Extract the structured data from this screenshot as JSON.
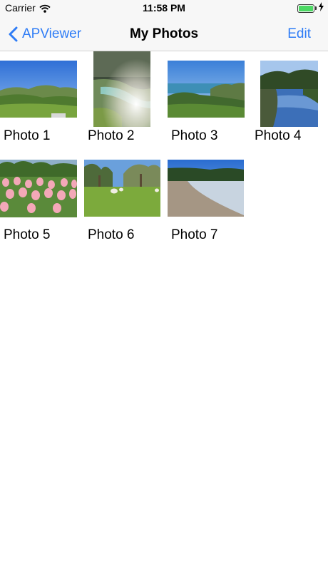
{
  "status_bar": {
    "carrier": "Carrier",
    "time": "11:58 PM"
  },
  "nav": {
    "back_label": "APViewer",
    "title": "My Photos",
    "edit_label": "Edit"
  },
  "photos": [
    {
      "label": "Photo 1",
      "scene": "green hills under blue sky"
    },
    {
      "label": "Photo 2",
      "scene": "sunlit stream through trees"
    },
    {
      "label": "Photo 3",
      "scene": "coastal cliffs and sea"
    },
    {
      "label": "Photo 4",
      "scene": "reflective pond with trees"
    },
    {
      "label": "Photo 5",
      "scene": "field of pink tulips"
    },
    {
      "label": "Photo 6",
      "scene": "sheep grazing in park"
    },
    {
      "label": "Photo 7",
      "scene": "curved sandy beach"
    }
  ]
}
